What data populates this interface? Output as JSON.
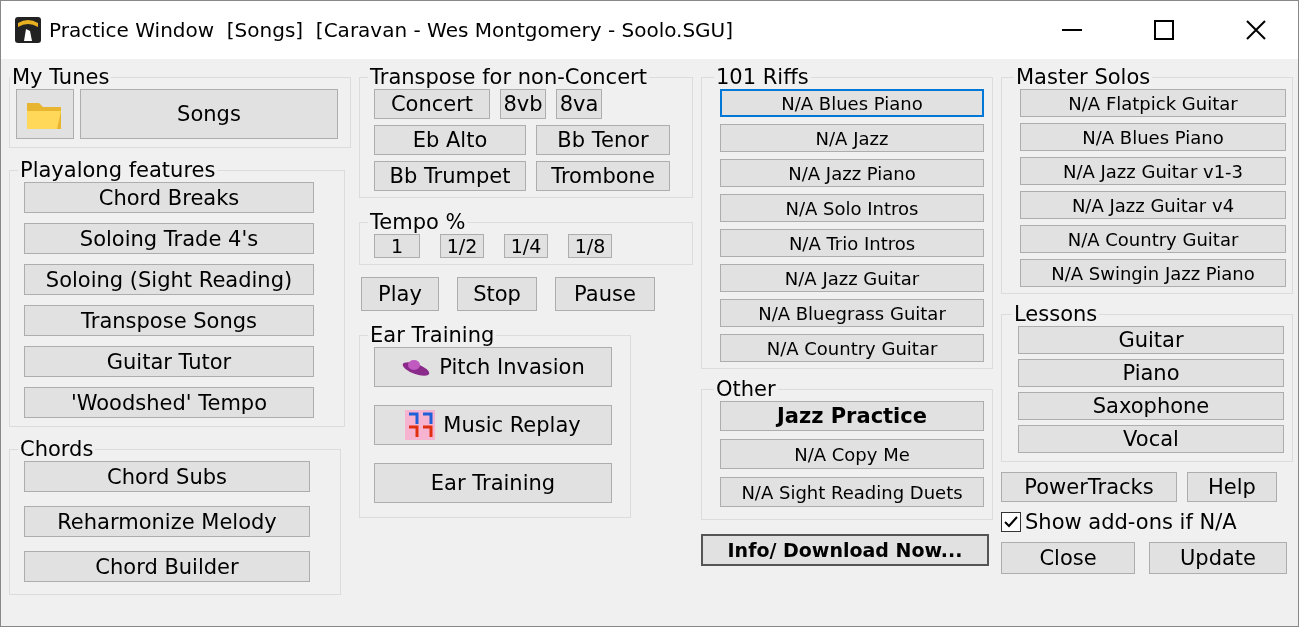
{
  "window": {
    "title": "Practice Window  [Songs]  [Caravan - Wes Montgomery - Soolo.SGU]"
  },
  "my_tunes": {
    "title": "My Tunes",
    "button": "Songs"
  },
  "playalong": {
    "title": "Playalong features",
    "buttons": [
      "Chord Breaks",
      "Soloing Trade 4's",
      "Soloing (Sight Reading)",
      "Transpose Songs",
      "Guitar Tutor",
      "'Woodshed' Tempo"
    ]
  },
  "chords": {
    "title": "Chords",
    "buttons": [
      "Chord Subs",
      "Reharmonize Melody",
      "Chord Builder"
    ]
  },
  "transpose": {
    "title": "Transpose for non-Concert",
    "rows": [
      [
        "Concert",
        "8vb",
        "8va"
      ],
      [
        "Eb Alto",
        "Bb Tenor"
      ],
      [
        "Bb Trumpet",
        "Trombone"
      ]
    ]
  },
  "tempo": {
    "title": "Tempo %",
    "buttons": [
      "1",
      "1/2",
      "1/4",
      "1/8"
    ]
  },
  "transport": [
    "Play",
    "Stop",
    "Pause"
  ],
  "ear_training": {
    "title": "Ear Training",
    "buttons": [
      {
        "label": "Pitch Invasion",
        "kind": "ufo"
      },
      {
        "label": "Music Replay",
        "kind": "notes"
      },
      {
        "label": "Ear Training",
        "kind": "plain"
      }
    ]
  },
  "riffs": {
    "title": "101 Riffs",
    "items": [
      {
        "label": "N/A Blues Piano",
        "focused": true
      },
      {
        "label": "N/A Jazz",
        "focused": false
      },
      {
        "label": "N/A Jazz Piano",
        "focused": false
      },
      {
        "label": "N/A Solo Intros",
        "focused": false
      },
      {
        "label": "N/A Trio Intros",
        "focused": false
      },
      {
        "label": "N/A Jazz Guitar",
        "focused": false
      },
      {
        "label": "N/A Bluegrass Guitar",
        "focused": false
      },
      {
        "label": "N/A Country Guitar",
        "focused": false
      }
    ]
  },
  "other": {
    "title": "Other",
    "items": [
      {
        "label": "Jazz Practice",
        "bold": true
      },
      {
        "label": "N/A Copy Me",
        "bold": false
      },
      {
        "label": "N/A Sight Reading Duets",
        "bold": false
      }
    ]
  },
  "info_button": "Info/ Download Now...",
  "master_solos": {
    "title": "Master Solos",
    "items": [
      "N/A Flatpick Guitar",
      "N/A Blues Piano",
      "N/A Jazz Guitar v1-3",
      "N/A Jazz Guitar v4",
      "N/A Country Guitar",
      "N/A Swingin Jazz Piano"
    ]
  },
  "lessons": {
    "title": "Lessons",
    "items": [
      "Guitar",
      "Piano",
      "Saxophone",
      "Vocal"
    ]
  },
  "tools": [
    "PowerTracks",
    "Help"
  ],
  "show_addons": {
    "label": "Show add-ons if N/A",
    "checked": true
  },
  "footer": [
    "Close",
    "Update"
  ]
}
